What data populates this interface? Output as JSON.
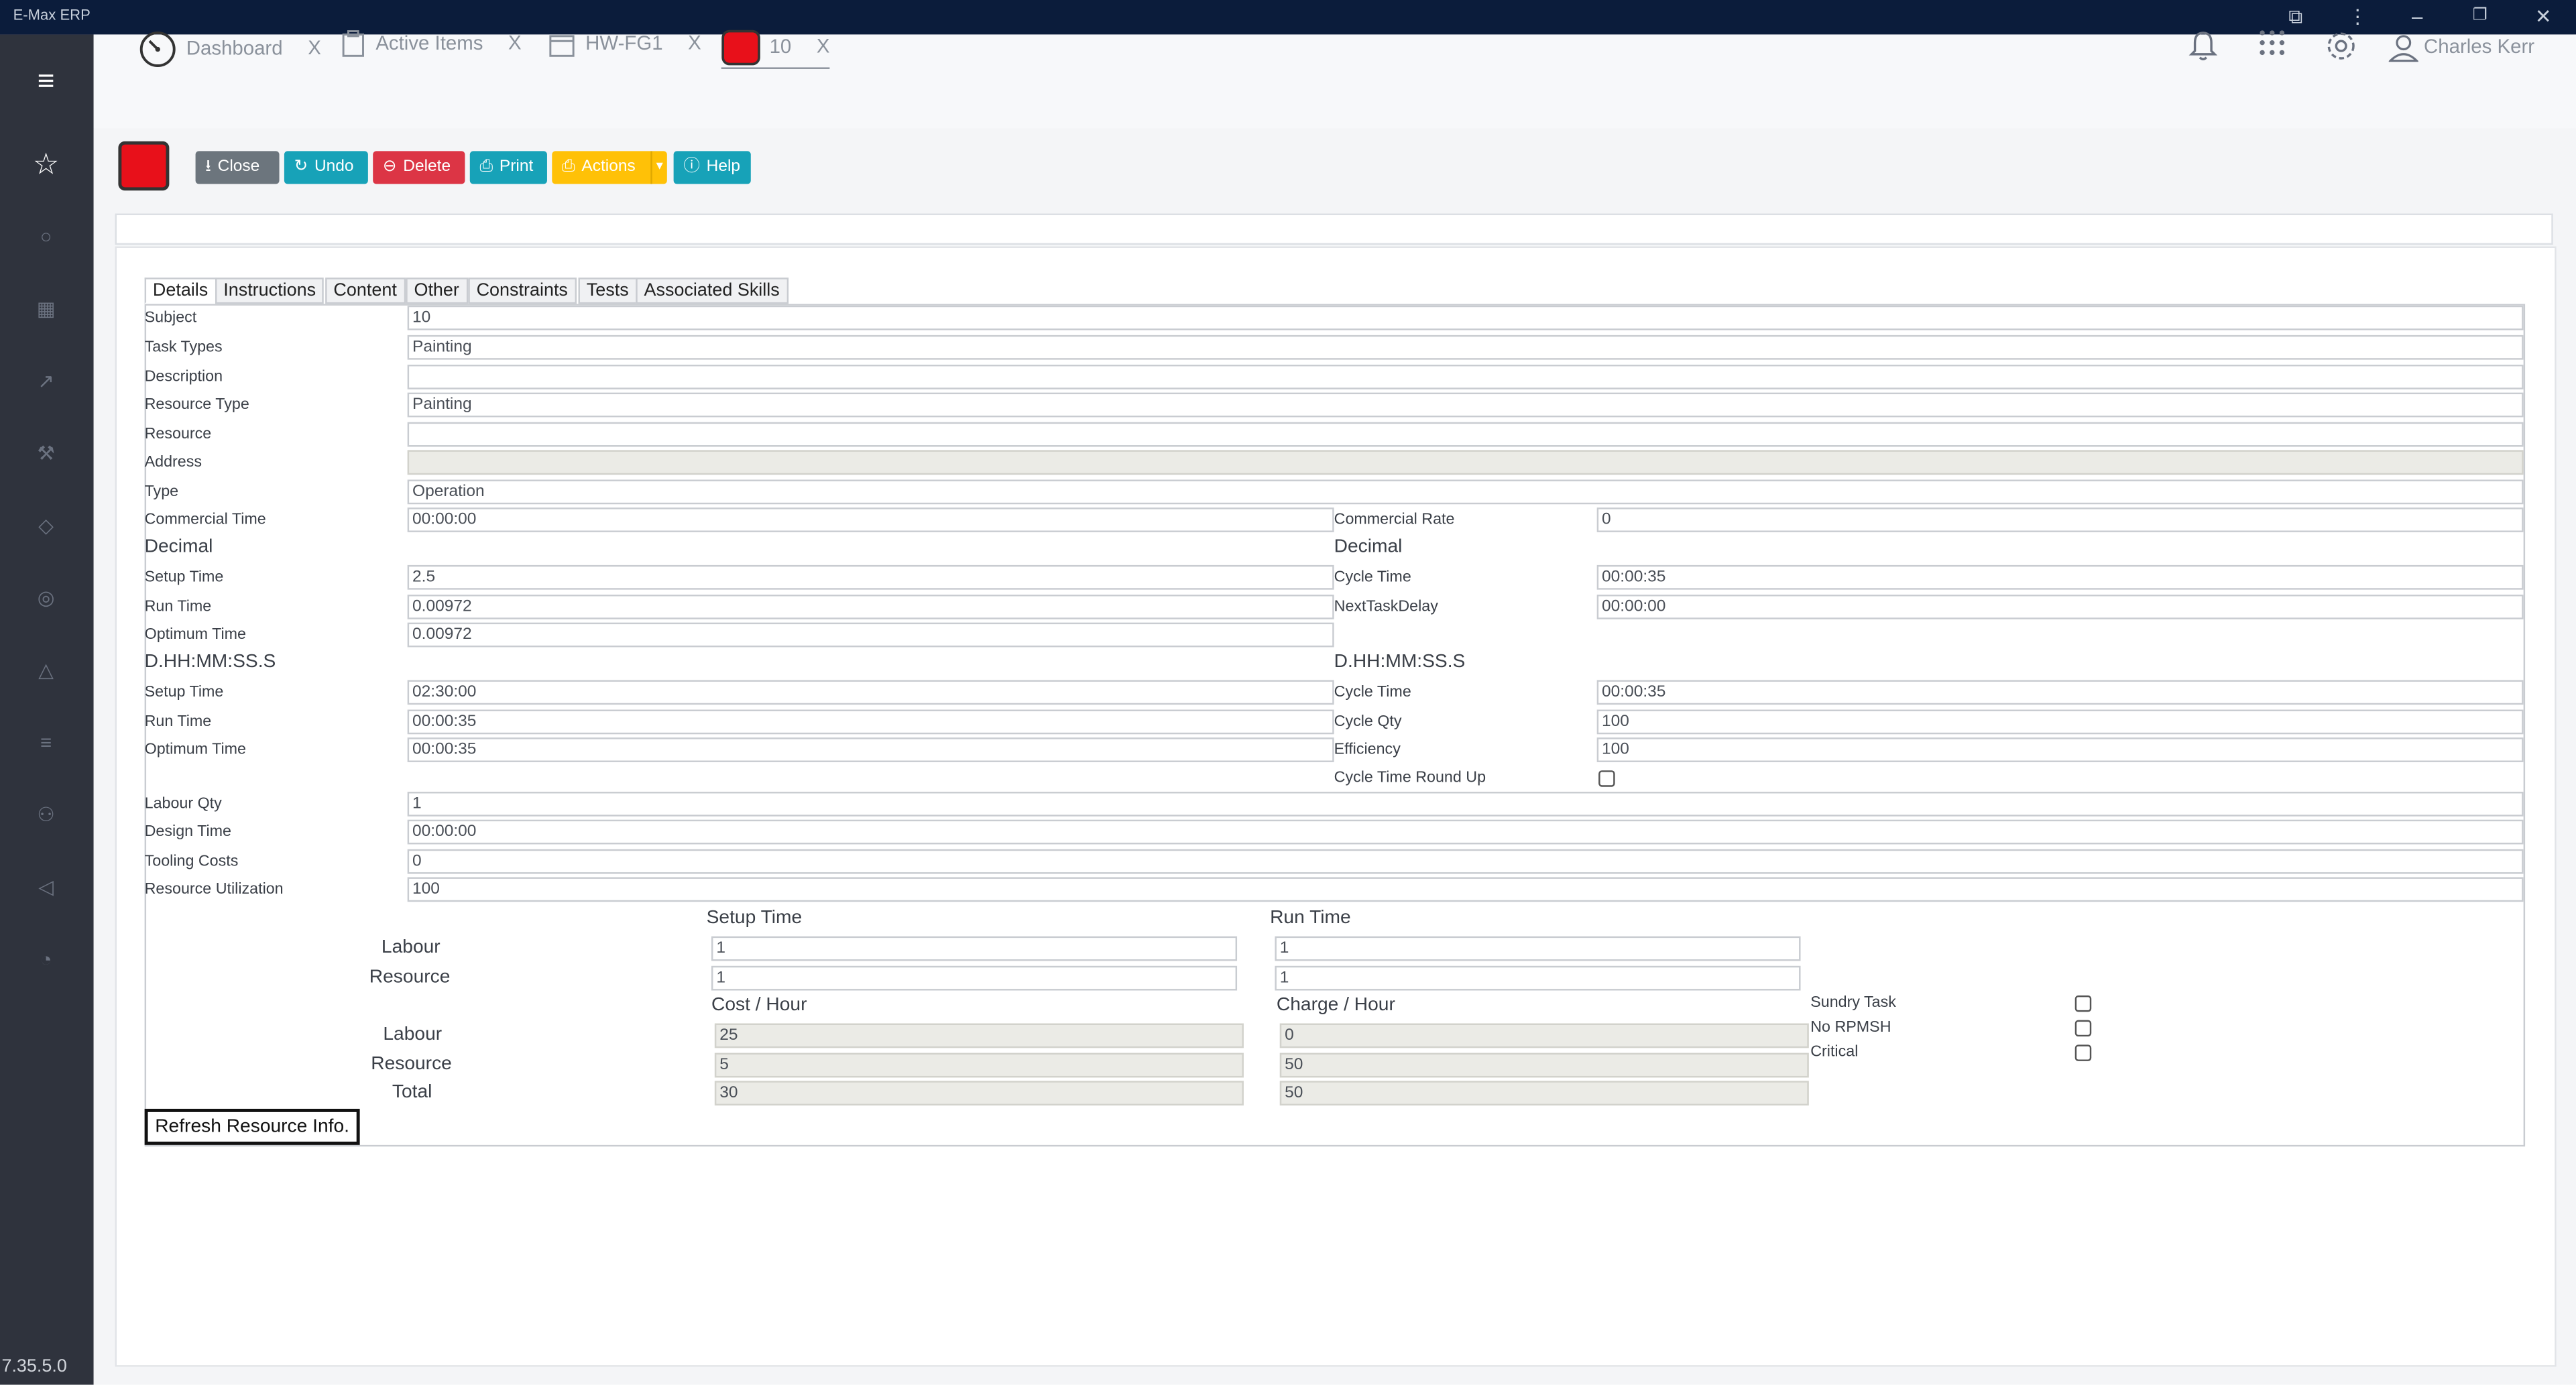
{
  "app": {
    "title": "E-Max ERP",
    "version": "7.35.5.0"
  },
  "tabs": [
    {
      "label": "Dashboard",
      "close": "X"
    },
    {
      "label": "Active Items",
      "close": "X"
    },
    {
      "label": "HW-FG1",
      "close": "X"
    },
    {
      "label": "10",
      "close": "X"
    }
  ],
  "user": {
    "name": "Charles Kerr"
  },
  "toolbar": {
    "close": "Close",
    "undo": "Undo",
    "delete": "Delete",
    "print": "Print",
    "actions": "Actions",
    "help": "Help"
  },
  "colors": {
    "titlebar": "#0b1c3b",
    "sidebar": "#2f333d",
    "close": "#6c757d",
    "undo": "#17a2b8",
    "delete": "#dc3545",
    "print": "#17a2b8",
    "actions": "#ffc107",
    "help": "#17a2b8",
    "status": "#e8101a"
  },
  "detail_tabs": [
    "Details",
    "Instructions",
    "Content",
    "Other",
    "Constraints",
    "Tests",
    "Associated Skills"
  ],
  "form": {
    "subject": {
      "label": "Subject",
      "value": "10"
    },
    "task_types": {
      "label": "Task Types",
      "value": "Painting"
    },
    "description": {
      "label": "Description",
      "value": ""
    },
    "resource_type": {
      "label": "Resource Type",
      "value": "Painting"
    },
    "resource": {
      "label": "Resource",
      "value": ""
    },
    "address": {
      "label": "Address",
      "value": ""
    },
    "type": {
      "label": "Type",
      "value": "Operation"
    },
    "commercial_time": {
      "label": "Commercial Time",
      "value": "00:00:00"
    },
    "commercial_rate": {
      "label": "Commercial Rate",
      "value": "0"
    },
    "decimal_heading": "Decimal",
    "setup_time_dec": {
      "label": "Setup Time",
      "value": "2.5"
    },
    "run_time_dec": {
      "label": "Run Time",
      "value": "0.00972"
    },
    "optimum_time_dec": {
      "label": "Optimum Time",
      "value": "0.00972"
    },
    "cycle_time_dec": {
      "label": "Cycle Time",
      "value": "00:00:35"
    },
    "next_task_delay": {
      "label": "NextTaskDelay",
      "value": "00:00:00"
    },
    "dhms_heading": "D.HH:MM:SS.S",
    "setup_time_hms": {
      "label": "Setup Time",
      "value": "02:30:00"
    },
    "run_time_hms": {
      "label": "Run Time",
      "value": "00:00:35"
    },
    "optimum_time_hms": {
      "label": "Optimum Time",
      "value": "00:00:35"
    },
    "cycle_time_hms": {
      "label": "Cycle Time",
      "value": "00:00:35"
    },
    "cycle_qty": {
      "label": "Cycle Qty",
      "value": "100"
    },
    "efficiency": {
      "label": "Efficiency",
      "value": "100"
    },
    "cycle_time_round_up": {
      "label": "Cycle Time Round Up"
    },
    "labour_qty": {
      "label": "Labour Qty",
      "value": "1"
    },
    "design_time": {
      "label": "Design Time",
      "value": "00:00:00"
    },
    "tooling_costs": {
      "label": "Tooling Costs",
      "value": "0"
    },
    "resource_utilization": {
      "label": "Resource Utilization",
      "value": "100"
    }
  },
  "costing": {
    "setup_time_header": "Setup Time",
    "run_time_header": "Run Time",
    "labour_label": "Labour",
    "resource_label": "Resource",
    "total_label": "Total",
    "setup_labour": "1",
    "setup_resource": "1",
    "run_labour": "1",
    "run_resource": "1",
    "cost_header": "Cost / Hour",
    "charge_header": "Charge / Hour",
    "cost_labour": "25",
    "cost_resource": "5",
    "cost_total": "30",
    "charge_labour": "0",
    "charge_resource": "50",
    "charge_total": "50",
    "sundry_task": "Sundry Task",
    "no_rpmsh": "No RPMSH",
    "critical": "Critical"
  },
  "refresh_button": "Refresh Resource Info."
}
